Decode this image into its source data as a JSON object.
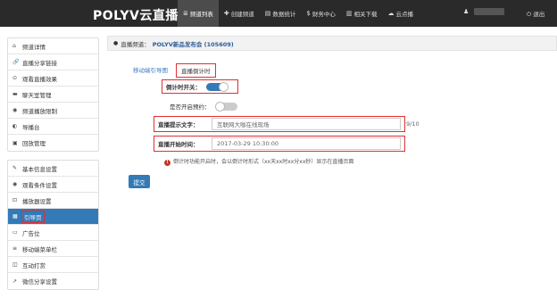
{
  "topbar": {
    "logo": "POLYV云直播",
    "nav": [
      {
        "icon": "≣",
        "label": "频道列表",
        "active": true
      },
      {
        "icon": "✚",
        "label": "创建频道"
      },
      {
        "icon": "▤",
        "label": "数据统计"
      },
      {
        "icon": "$",
        "label": "财务中心"
      },
      {
        "icon": "▥",
        "label": "相关下载"
      },
      {
        "icon": "☁",
        "label": "云点播"
      }
    ],
    "user_icon": "♟",
    "logout_icon": "⏻",
    "logout": "退出"
  },
  "sidebar": {
    "group1": [
      {
        "icon": "⌂",
        "label": "频道详情"
      },
      {
        "icon": "🔗",
        "label": "直播分享链接"
      },
      {
        "icon": "⊙",
        "label": "观看直播效果"
      },
      {
        "icon": "▬",
        "label": "聊天室管理"
      },
      {
        "icon": "◉",
        "label": "频道播放限制"
      },
      {
        "icon": "◐",
        "label": "导播台"
      },
      {
        "icon": "▣",
        "label": "回放管理"
      }
    ],
    "group2": [
      {
        "icon": "✎",
        "label": "基本信息设置"
      },
      {
        "icon": "◉",
        "label": "观看条件设置"
      },
      {
        "icon": "⊡",
        "label": "播放器设置"
      },
      {
        "icon": "▦",
        "label": "引导页",
        "active": true
      },
      {
        "icon": "▭",
        "label": "广告位"
      },
      {
        "icon": "≡",
        "label": "移动端菜单栏"
      },
      {
        "icon": "◫",
        "label": "互动打赏"
      },
      {
        "icon": "↗",
        "label": "微信分享设置"
      }
    ]
  },
  "content": {
    "crumb_prefix": "直播频道：",
    "crumb_name": "POLYV新品发布会 (105609)",
    "tabs": [
      {
        "label": "移动端引导图"
      },
      {
        "label": "直播倒计时",
        "active": true
      }
    ],
    "countdown_label": "倒计时开关：",
    "countdown_on": true,
    "reserve_label": "是否开启预约：",
    "reserve_on": false,
    "tip_label": "直播提示文字：",
    "tip_value": "互联网大咖在线现场",
    "tip_count": "9/10",
    "start_label": "直播开始时间：",
    "start_value": "2017-03-29 10:30:00",
    "hint": "倒计时功能开启时，会以倒计时形式（xx天xx时xx分xx秒）显示在直播页面",
    "submit": "提交"
  }
}
